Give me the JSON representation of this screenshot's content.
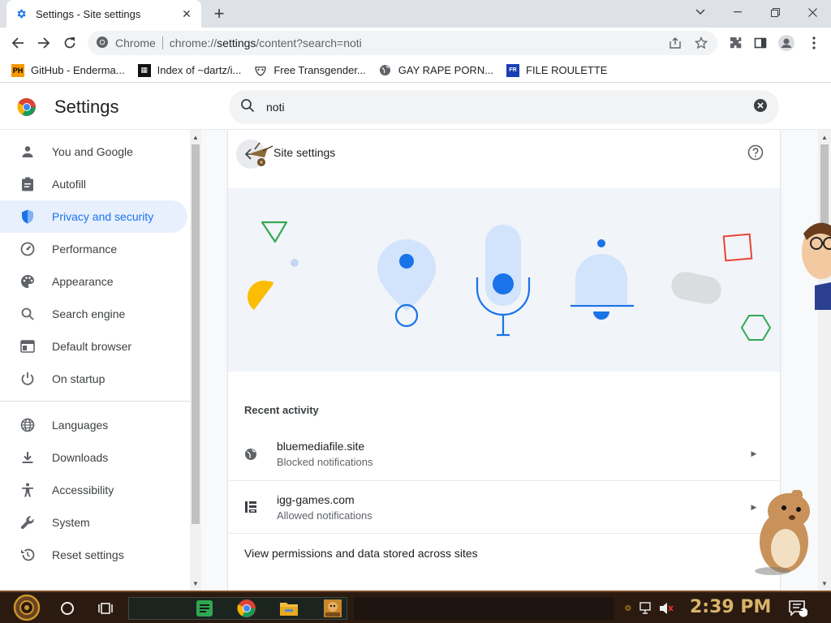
{
  "browser": {
    "tab_title": "Settings - Site settings",
    "site_chip": "Chrome",
    "url_prefix": "chrome://",
    "url_host": "settings",
    "url_rest": "/content?search=noti"
  },
  "bookmarks": [
    {
      "label": "GitHub - Enderma...",
      "icon": "PH"
    },
    {
      "label": "Index of ~dartz/i...",
      "icon": "34"
    },
    {
      "label": "Free Transgender...",
      "icon": "mask"
    },
    {
      "label": "GAY RAPE PORN...",
      "icon": "globe"
    },
    {
      "label": "FILE ROULETTE",
      "icon": "FR"
    }
  ],
  "settings": {
    "title": "Settings",
    "search_query": "noti"
  },
  "sidebar": {
    "items": [
      {
        "label": "You and Google",
        "icon": "person-icon"
      },
      {
        "label": "Autofill",
        "icon": "clipboard-icon"
      },
      {
        "label": "Privacy and security",
        "icon": "shield-icon",
        "active": true
      },
      {
        "label": "Performance",
        "icon": "speedometer-icon"
      },
      {
        "label": "Appearance",
        "icon": "palette-icon"
      },
      {
        "label": "Search engine",
        "icon": "search-icon"
      },
      {
        "label": "Default browser",
        "icon": "browser-icon"
      },
      {
        "label": "On startup",
        "icon": "power-icon"
      }
    ],
    "advanced_items": [
      {
        "label": "Languages",
        "icon": "globe-icon"
      },
      {
        "label": "Downloads",
        "icon": "download-icon"
      },
      {
        "label": "Accessibility",
        "icon": "accessibility-icon"
      },
      {
        "label": "System",
        "icon": "wrench-icon"
      },
      {
        "label": "Reset settings",
        "icon": "reset-icon"
      }
    ]
  },
  "card": {
    "title": "Site settings",
    "recent_activity_label": "Recent activity",
    "rows": [
      {
        "site": "bluemediafile.site",
        "status": "Blocked notifications",
        "icon": "globe-icon"
      },
      {
        "site": "igg-games.com",
        "status": "Allowed notifications",
        "icon": "igg-icon"
      }
    ],
    "view_permissions_label": "View permissions and data stored across sites"
  },
  "taskbar": {
    "clock": "2:39 PM",
    "notification_count": "2"
  },
  "colors": {
    "accent": "#1a73e8",
    "active_bg": "#e8f0fe",
    "banner_bg": "#f1f4f9",
    "illustration_blue": "#d2e3fc",
    "illustration_dot": "#4285f4"
  }
}
